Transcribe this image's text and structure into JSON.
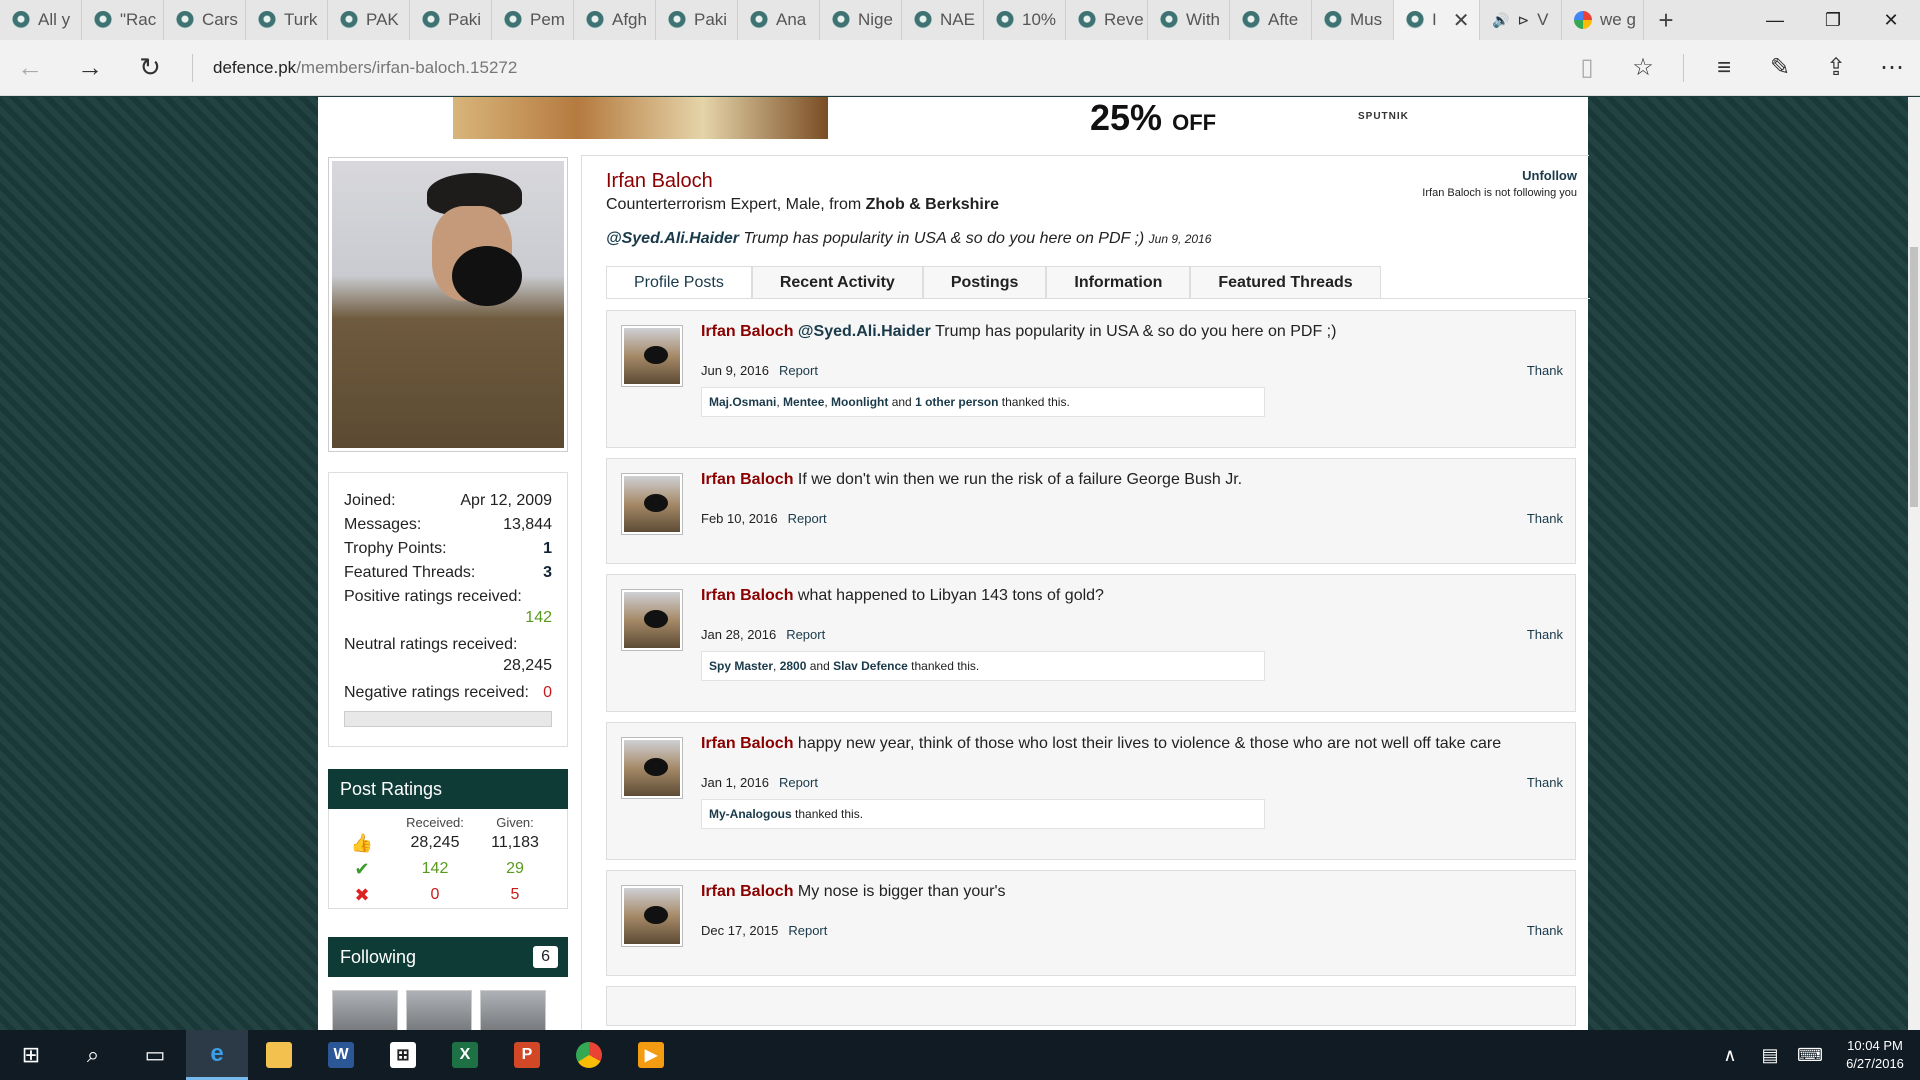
{
  "browser": {
    "tabs": [
      {
        "label": "All y"
      },
      {
        "label": "\"Rac"
      },
      {
        "label": "Cars"
      },
      {
        "label": "Turk"
      },
      {
        "label": "PAK"
      },
      {
        "label": "Paki"
      },
      {
        "label": "Pem"
      },
      {
        "label": "Afgh"
      },
      {
        "label": "Paki"
      },
      {
        "label": "Ana"
      },
      {
        "label": "Nige"
      },
      {
        "label": "NAE"
      },
      {
        "label": "10%"
      },
      {
        "label": "Reve"
      },
      {
        "label": "With"
      },
      {
        "label": "Afte"
      },
      {
        "label": "Mus"
      }
    ],
    "active_tab_label": "I",
    "audio_tab_label": "V",
    "google_tab_label": "we g",
    "url_host": "defence.pk",
    "url_path": "/members/irfan-baloch.15272"
  },
  "ad": {
    "discount": "25%",
    "off": "OFF",
    "brand": "SPUTNIK"
  },
  "sidebar": {
    "stats": [
      {
        "label": "Joined:",
        "value": "Apr 12, 2009"
      },
      {
        "label": "Messages:",
        "value": "13,844"
      },
      {
        "label": "Trophy Points:",
        "value": "1"
      },
      {
        "label": "Featured Threads:",
        "value": "3"
      }
    ],
    "positive_label": "Positive ratings received:",
    "positive_value": "142",
    "neutral_label": "Neutral ratings received:",
    "neutral_value": "28,245",
    "negative_label": "Negative ratings received:",
    "negative_value": "0",
    "post_ratings_title": "Post Ratings",
    "ratings_received_hdr": "Received:",
    "ratings_given_hdr": "Given:",
    "ratings": [
      {
        "icon": "thumbs-up-icon",
        "received": "28,245",
        "given": "11,183"
      },
      {
        "icon": "check-icon",
        "received": "142",
        "given": "29"
      },
      {
        "icon": "cross-icon",
        "received": "0",
        "given": "5"
      }
    ],
    "following_title": "Following",
    "following_count": "6"
  },
  "profile": {
    "name": "Irfan Baloch",
    "title_prefix": "Counterterrorism Expert, Male, from ",
    "location": "Zhob & Berkshire",
    "unfollow": "Unfollow",
    "not_following": "Irfan Baloch is not following you",
    "status_mention": "@Syed.Ali.Haider",
    "status_text": " Trump has popularity in USA & so do you here on PDF ;)",
    "status_date": "Jun 9, 2016",
    "tabs": [
      "Profile Posts",
      "Recent Activity",
      "Postings",
      "Information",
      "Featured Threads"
    ]
  },
  "posts": [
    {
      "author": "Irfan Baloch",
      "mention": "@Syed.Ali.Haider",
      "text": " Trump has popularity in USA & so do you here on PDF ;)",
      "date": "Jun 9, 2016",
      "report": "Report",
      "thank": "Thank",
      "liked": [
        {
          "t": "Maj.Osmani",
          "b": true
        },
        {
          "t": ", ",
          "b": false
        },
        {
          "t": "Mentee",
          "b": true
        },
        {
          "t": ", ",
          "b": false
        },
        {
          "t": "Moonlight",
          "b": true
        },
        {
          "t": " and ",
          "b": false
        },
        {
          "t": "1 other person",
          "b": true
        },
        {
          "t": " thanked this.",
          "b": false
        }
      ]
    },
    {
      "author": "Irfan Baloch",
      "mention": "",
      "text": " If we don't win then we run the risk of a failure George Bush Jr.",
      "date": "Feb 10, 2016",
      "report": "Report",
      "thank": "Thank",
      "liked": []
    },
    {
      "author": "Irfan Baloch",
      "mention": "",
      "text": " what happened to Libyan 143 tons of gold?",
      "date": "Jan 28, 2016",
      "report": "Report",
      "thank": "Thank",
      "liked": [
        {
          "t": "Spy Master",
          "b": true
        },
        {
          "t": ", ",
          "b": false
        },
        {
          "t": "2800",
          "b": true
        },
        {
          "t": " and ",
          "b": false
        },
        {
          "t": "Slav Defence",
          "b": true
        },
        {
          "t": " thanked this.",
          "b": false
        }
      ]
    },
    {
      "author": "Irfan Baloch",
      "mention": "",
      "text": " happy new year, think of those who lost their lives to violence & those who are not well off take care",
      "date": "Jan 1, 2016",
      "report": "Report",
      "thank": "Thank",
      "liked": [
        {
          "t": "My-Analogous",
          "b": true
        },
        {
          "t": " thanked this.",
          "b": false
        }
      ]
    },
    {
      "author": "Irfan Baloch",
      "mention": "",
      "text": " My nose is bigger than your's",
      "date": "Dec 17, 2015",
      "report": "Report",
      "thank": "Thank",
      "liked": []
    }
  ],
  "taskbar": {
    "time": "10:04 PM",
    "date": "6/27/2016"
  }
}
